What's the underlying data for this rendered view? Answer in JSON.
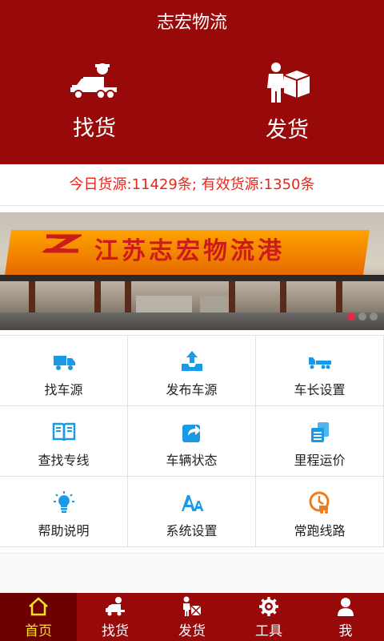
{
  "app": {
    "title": "志宏物流"
  },
  "top_actions": [
    {
      "label": "找货",
      "icon": "truck-driver-icon"
    },
    {
      "label": "发货",
      "icon": "person-box-icon"
    }
  ],
  "stats_text": "今日货源:11429条; 有效货源:1350条",
  "banner": {
    "text": "江苏志宏物流港",
    "logo": "z-logo",
    "slides": 3,
    "active_slide": 1
  },
  "menu": [
    {
      "label": "找车源",
      "icon": "truck-icon"
    },
    {
      "label": "发布车源",
      "icon": "upload-tray-icon"
    },
    {
      "label": "车长设置",
      "icon": "long-truck-icon"
    },
    {
      "label": "查找专线",
      "icon": "open-book-icon"
    },
    {
      "label": "车辆状态",
      "icon": "share-box-icon"
    },
    {
      "label": "里程运价",
      "icon": "calculator-icon"
    },
    {
      "label": "帮助说明",
      "icon": "lightbulb-icon"
    },
    {
      "label": "系统设置",
      "icon": "font-aa-icon"
    },
    {
      "label": "常跑线路",
      "icon": "route-clock-icon"
    }
  ],
  "tabs": [
    {
      "label": "首页",
      "icon": "home-icon",
      "active": true
    },
    {
      "label": "找货",
      "icon": "truck-driver-icon"
    },
    {
      "label": "发货",
      "icon": "person-box-icon"
    },
    {
      "label": "工具",
      "icon": "gear-icon"
    },
    {
      "label": "我",
      "icon": "user-icon"
    }
  ],
  "colors": {
    "brand": "#980a0a",
    "active_tab": "#6d0000",
    "active_tab_text": "#ffe21f",
    "accent_blue": "#1a9ae6",
    "accent_orange": "#f07b1b",
    "stats_text": "#e5281d"
  }
}
